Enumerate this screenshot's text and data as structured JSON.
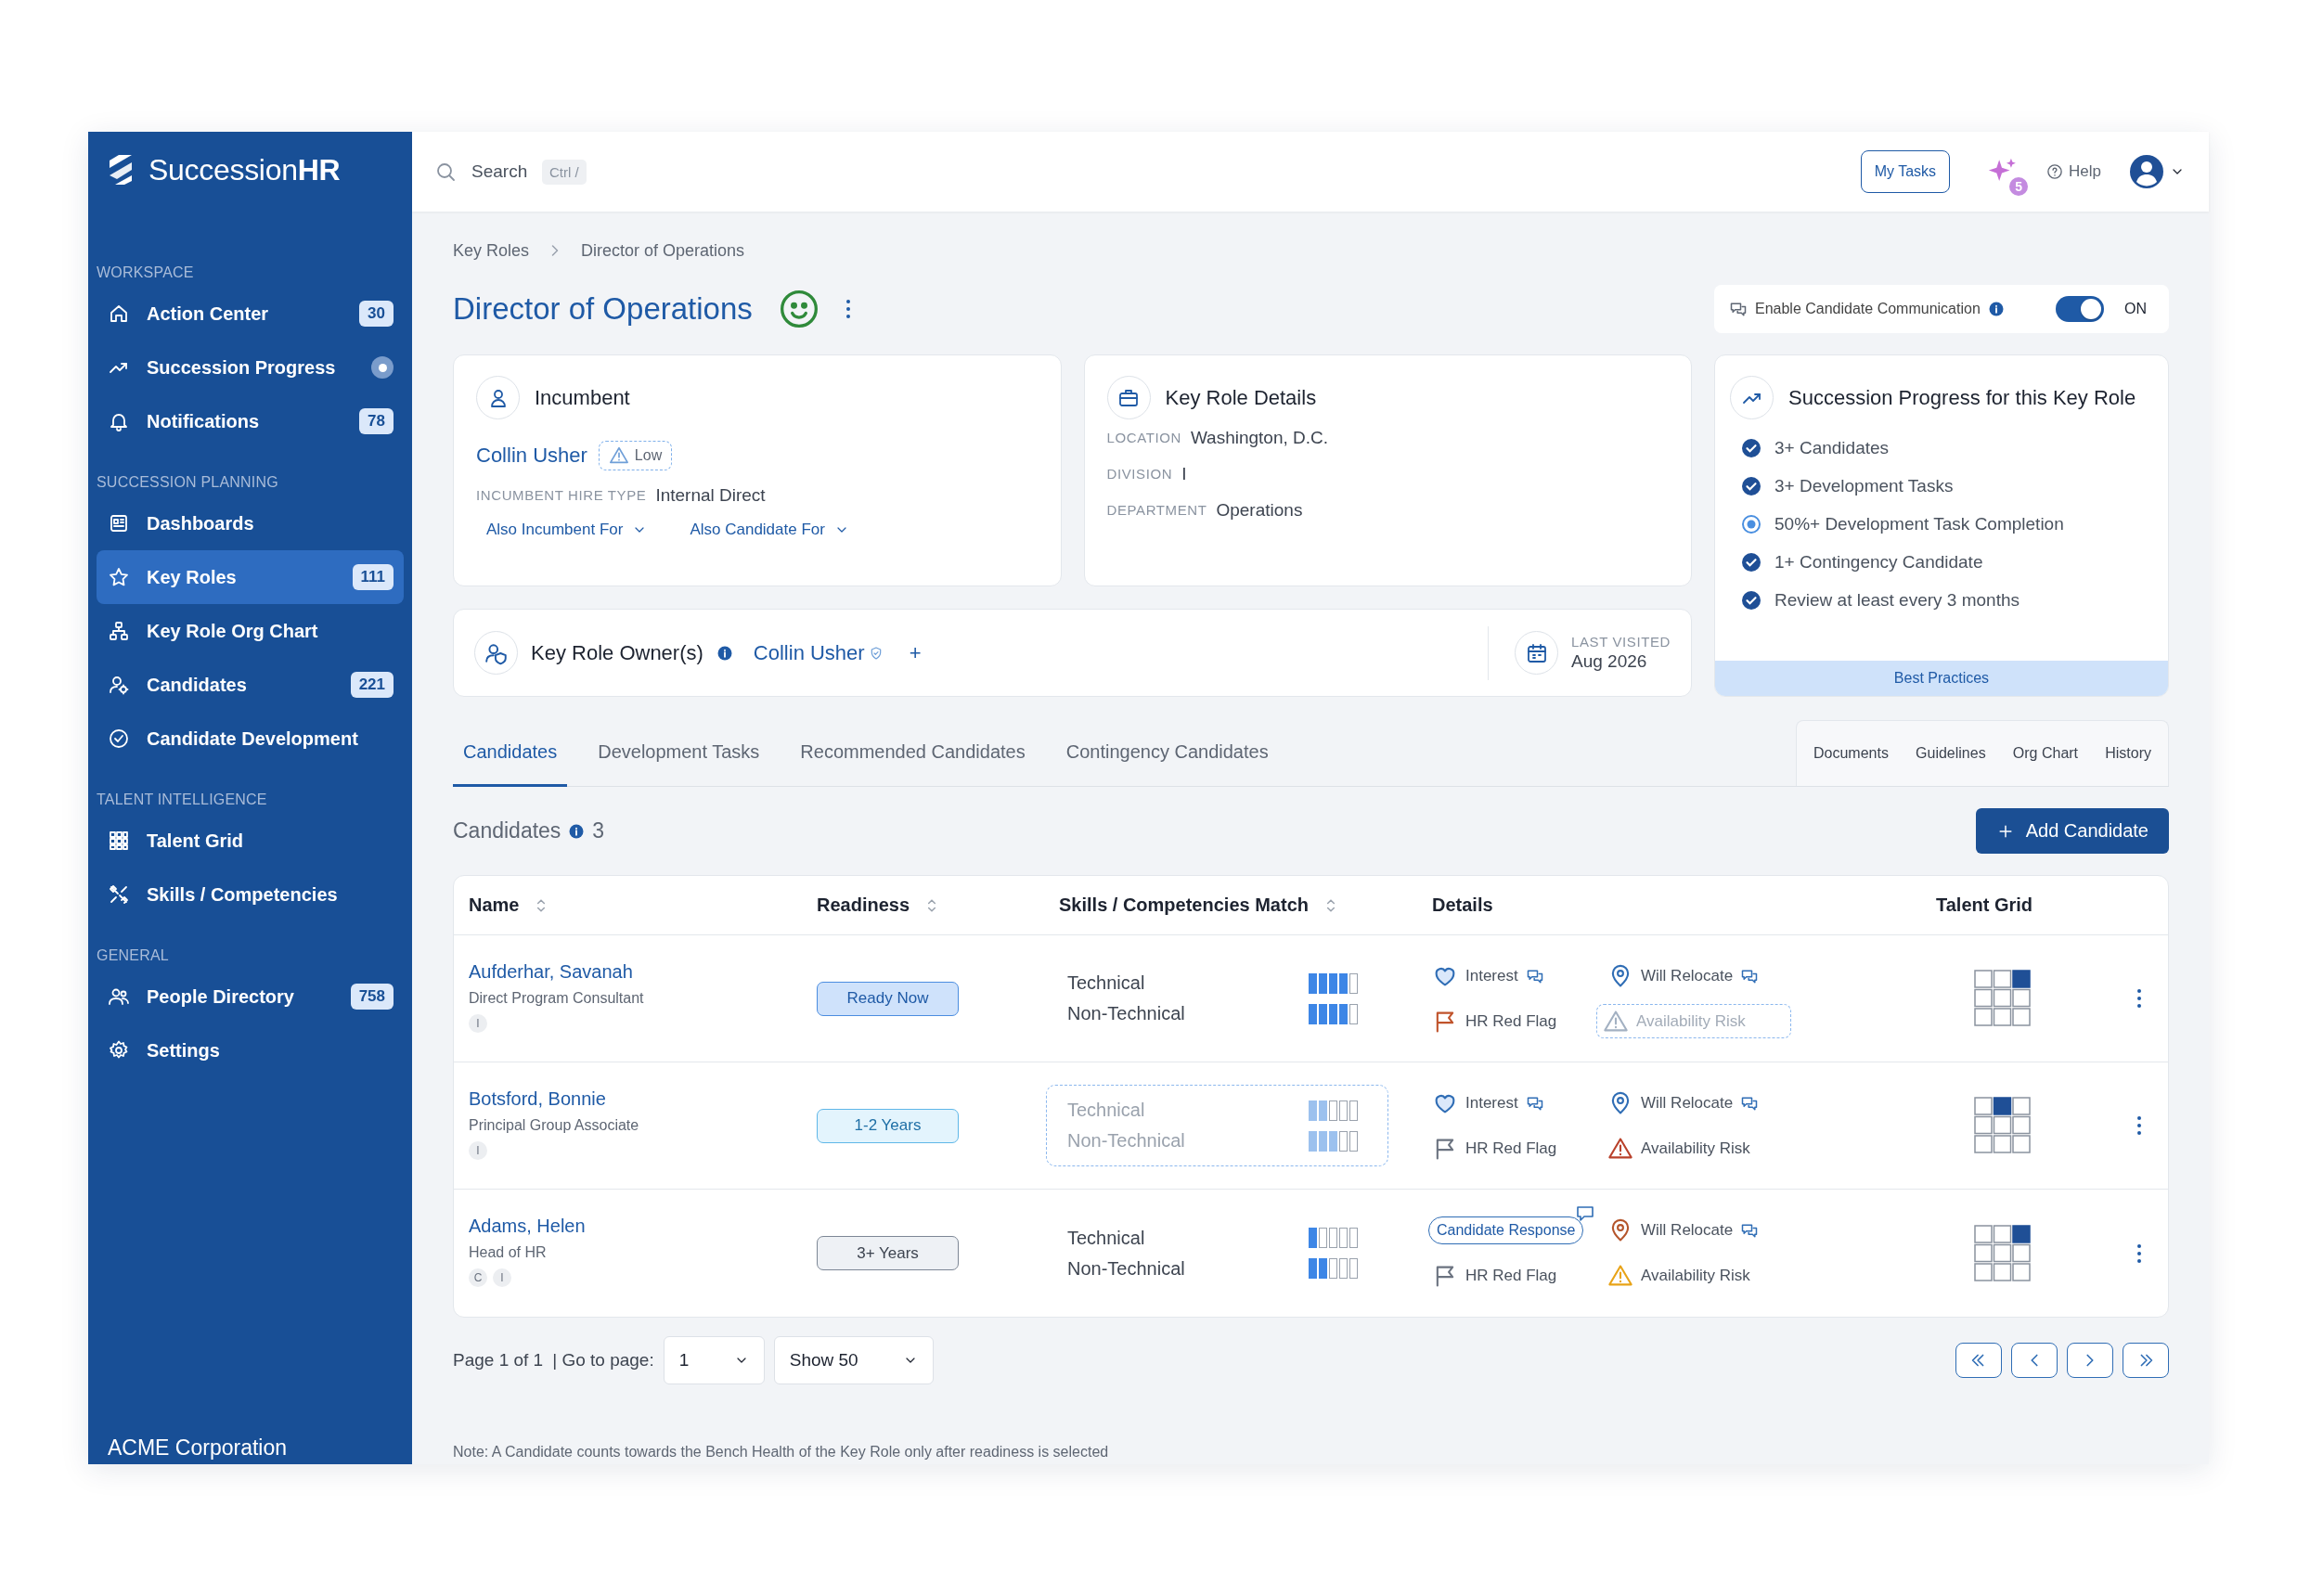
{
  "brand": {
    "name": "Succession**HR**"
  },
  "sidebar": {
    "sections": [
      {
        "title": "WORKSPACE",
        "items": [
          {
            "label": "Action Center",
            "badge": "30",
            "selected": false
          },
          {
            "label": "Succession Progress",
            "indicator": true,
            "selected": false
          },
          {
            "label": "Notifications",
            "badge": "78",
            "selected": false
          }
        ]
      },
      {
        "title": "SUCCESSION PLANNING",
        "items": [
          {
            "label": "Dashboards",
            "selected": false
          },
          {
            "label": "Key Roles",
            "badge": "111",
            "selected": true
          },
          {
            "label": "Key Role Org Chart",
            "selected": false
          },
          {
            "label": "Candidates",
            "badge": "221",
            "selected": false
          },
          {
            "label": "Candidate Development",
            "selected": false
          }
        ]
      },
      {
        "title": "TALENT INTELLIGENCE",
        "items": [
          {
            "label": "Talent Grid",
            "selected": false
          },
          {
            "label": "Skills / Competencies",
            "selected": false
          }
        ]
      },
      {
        "title": "GENERAL",
        "items": [
          {
            "label": "People Directory",
            "badge": "758",
            "selected": false
          },
          {
            "label": "Settings",
            "selected": false
          }
        ]
      }
    ],
    "footer": "ACME Corporation"
  },
  "topbar": {
    "search": {
      "placeholder": "Search",
      "shortcut": "Ctrl /"
    },
    "tasks_button": "My Tasks",
    "assistant_badge": "5",
    "help": "Help"
  },
  "breadcrumb": [
    "Key Roles",
    "Director of Operations"
  ],
  "title": "Director of Operations",
  "communication": {
    "label": "Enable Candidate Communication",
    "on": true,
    "state_label": "ON"
  },
  "incumbent": {
    "title": "Incumbent",
    "name": "Collin Usher",
    "risk": "Low",
    "fields": [
      {
        "label": "INCUMBENT HIRE TYPE",
        "value": "Internal Direct"
      }
    ],
    "links": [
      "Also Incumbent For",
      "Also Candidate For"
    ]
  },
  "key_role_details": {
    "title": "Key Role Details",
    "fields": [
      {
        "label": "LOCATION",
        "value": "Washington, D.C."
      },
      {
        "label": "DIVISION",
        "value": "I"
      },
      {
        "label": "DEPARTMENT",
        "value": "Operations"
      }
    ]
  },
  "owners": {
    "title": "Key Role Owner(s)",
    "owner": "Collin Usher",
    "add": "+",
    "last_visited": {
      "label": "LAST VISITED",
      "value": "Aug 2026"
    }
  },
  "progress": {
    "title": "Succession Progress for this Key Role",
    "items": [
      {
        "label": "3+ Candidates",
        "checked": true
      },
      {
        "label": "3+ Development Tasks",
        "checked": true
      },
      {
        "label": "50%+ Development Task Completion",
        "checked": false
      },
      {
        "label": "1+ Contingency Candidate",
        "checked": true
      },
      {
        "label": "Review at least every 3 months",
        "checked": true
      }
    ],
    "footer": "Best Practices"
  },
  "tabs": [
    {
      "label": "Candidates",
      "selected": true
    },
    {
      "label": "Development Tasks",
      "selected": false
    },
    {
      "label": "Recommended Candidates",
      "selected": false
    },
    {
      "label": "Contingency Candidates",
      "selected": false
    }
  ],
  "side_links": [
    "Documents",
    "Guidelines",
    "Org Chart",
    "History"
  ],
  "candidates": {
    "title": "Candidates",
    "count": "3",
    "add_button": "Add Candidate",
    "columns": [
      {
        "label": "Name",
        "sortable": true
      },
      {
        "label": "Readiness",
        "sortable": true
      },
      {
        "label": "Skills / Competencies Match",
        "sortable": true
      },
      {
        "label": "Details",
        "sortable": false
      },
      {
        "label": "Talent Grid",
        "sortable": false
      }
    ],
    "rows": [
      {
        "name": "Aufderhar, Savanah",
        "role": "Direct Program Consultant",
        "tags": [
          "I"
        ],
        "readiness": {
          "label": "Ready Now",
          "kind": "ready"
        },
        "skills_pending": false,
        "skills": [
          {
            "label": "Technical",
            "level": 0.8
          },
          {
            "label": "Non-Technical",
            "level": 0.8
          }
        ],
        "details": [
          {
            "kind": "interest",
            "label": "Interest",
            "comment": true
          },
          {
            "kind": "relocate",
            "label": "Will Relocate",
            "comment": true,
            "color": "#2f6db5"
          },
          {
            "kind": "flag",
            "label": "HR Red Flag",
            "on": true
          },
          {
            "kind": "risk",
            "label": "Availability Risk",
            "pending": true,
            "color": "#a3b1c2"
          }
        ],
        "grid": [
          {
            "selected": false
          },
          {
            "selected": false
          },
          {
            "selected": true
          },
          {
            "selected": false
          },
          {
            "selected": false
          },
          {
            "selected": false
          },
          {
            "selected": false
          },
          {
            "selected": false
          },
          {
            "selected": false
          }
        ]
      },
      {
        "name": "Botsford, Bonnie",
        "role": "Principal Group Associate",
        "tags": [
          "I"
        ],
        "readiness": {
          "label": "1-2 Years",
          "kind": "near"
        },
        "skills_pending": true,
        "skills": [
          {
            "label": "Technical",
            "level": 0.4
          },
          {
            "label": "Non-Technical",
            "level": 0.6
          }
        ],
        "details": [
          {
            "kind": "interest",
            "label": "Interest",
            "comment": true
          },
          {
            "kind": "relocate",
            "label": "Will Relocate",
            "comment": true,
            "color": "#2f6db5"
          },
          {
            "kind": "flag",
            "label": "HR Red Flag",
            "on": false
          },
          {
            "kind": "risk",
            "label": "Availability Risk",
            "pending": false,
            "color": "#b9412b"
          }
        ],
        "grid": [
          {
            "selected": false
          },
          {
            "selected": true
          },
          {
            "selected": false
          },
          {
            "selected": false
          },
          {
            "selected": false
          },
          {
            "selected": false
          },
          {
            "selected": false
          },
          {
            "selected": false
          },
          {
            "selected": false
          }
        ]
      },
      {
        "name": "Adams, Helen",
        "role": "Head of HR",
        "tags": [
          "C",
          "I"
        ],
        "readiness": {
          "label": "3+ Years",
          "kind": "far"
        },
        "skills_pending": false,
        "skills": [
          {
            "label": "Technical",
            "level": 0.2
          },
          {
            "label": "Non-Technical",
            "level": 0.4
          }
        ],
        "details": [
          {
            "kind": "response",
            "label": "Candidate Response"
          },
          {
            "kind": "relocate",
            "label": "Will Relocate",
            "comment": true,
            "color": "#b5552b"
          },
          {
            "kind": "flag",
            "label": "HR Red Flag",
            "on": false
          },
          {
            "kind": "risk",
            "label": "Availability Risk",
            "pending": false,
            "color": "#e8a317"
          }
        ],
        "grid": [
          {
            "selected": false
          },
          {
            "selected": false
          },
          {
            "selected": true
          },
          {
            "selected": false
          },
          {
            "selected": false
          },
          {
            "selected": false
          },
          {
            "selected": false
          },
          {
            "selected": false
          },
          {
            "selected": false
          }
        ]
      }
    ]
  },
  "pagination": {
    "page_info": "Page 1 of 1",
    "goto_label": "| Go to page:",
    "page": "1",
    "page_size": "Show 50"
  },
  "note": "Note: A Candidate counts towards the Bench Health of the Key Role only after readiness is selected"
}
